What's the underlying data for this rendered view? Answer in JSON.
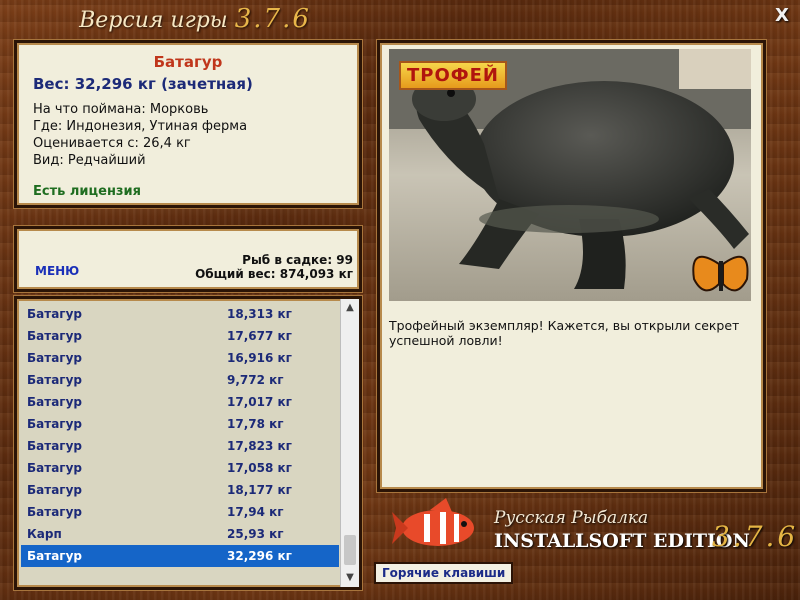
{
  "window": {
    "title_prefix": "Версия игры",
    "title_version": "3.7.6",
    "close_symbol": "X"
  },
  "fish_info": {
    "name": "Батагур",
    "weight": "Вес: 32,296 кг (зачетная)",
    "caught_with": "На что поймана: Морковь",
    "where": "Где: Индонезия, Утиная ферма",
    "valued_from": "Оценивается с: 26,4 кг",
    "kind": "Вид: Редчайший",
    "license": "Есть лицензия"
  },
  "stats": {
    "menu_label": "МЕНЮ",
    "fish_in_cage": "Рыб в садке: 99",
    "total_weight": "Общий вес: 874,093 кг"
  },
  "catch_list": [
    {
      "name": "Батагур",
      "weight": "18,313 кг"
    },
    {
      "name": "Батагур",
      "weight": "17,677 кг"
    },
    {
      "name": "Батагур",
      "weight": "16,916 кг"
    },
    {
      "name": "Батагур",
      "weight": "9,772 кг"
    },
    {
      "name": "Батагур",
      "weight": "17,017 кг"
    },
    {
      "name": "Батагур",
      "weight": "17,78 кг"
    },
    {
      "name": "Батагур",
      "weight": "17,823 кг"
    },
    {
      "name": "Батагур",
      "weight": "17,058 кг"
    },
    {
      "name": "Батагур",
      "weight": "18,177 кг"
    },
    {
      "name": "Батагур",
      "weight": "17,94 кг"
    },
    {
      "name": "Карп",
      "weight": "25,93 кг"
    },
    {
      "name": "Батагур",
      "weight": "32,296 кг",
      "selected": true
    }
  ],
  "photo": {
    "badge": "ТРОФЕЙ",
    "caption": "Трофейный экземпляр! Кажется, вы открыли секрет успешной ловли!"
  },
  "branding": {
    "line1": "Русская Рыбалка",
    "line2": "INSTALLSOFT EDITION",
    "version": "3.7.6"
  },
  "hotkeys_label": "Горячие клавиши"
}
